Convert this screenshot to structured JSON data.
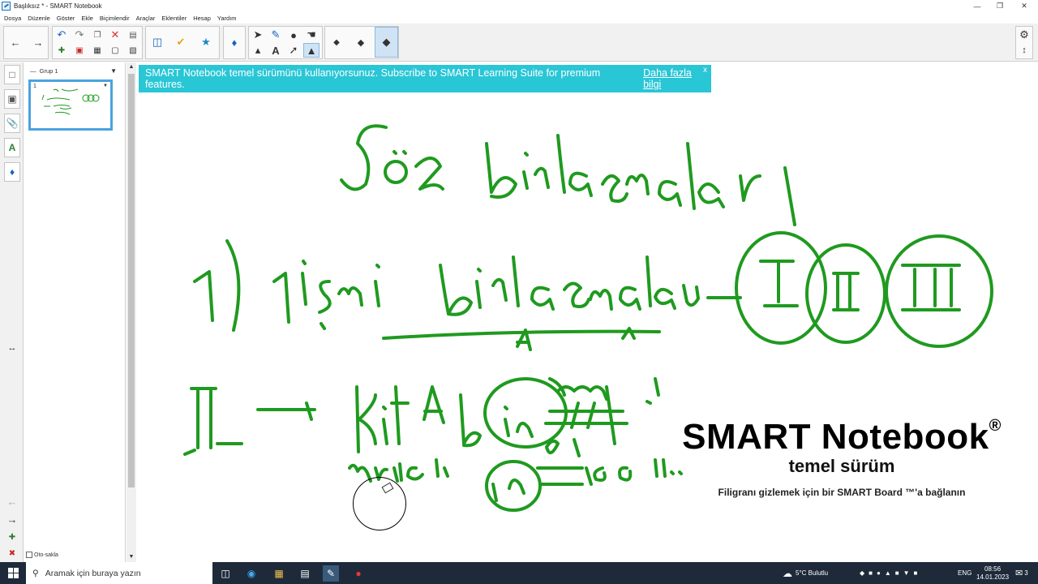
{
  "window": {
    "title": "Başlıksız * - SMART Notebook",
    "controls": [
      "minimize-icon",
      "restore-icon",
      "close-icon"
    ]
  },
  "menu": [
    "Dosya",
    "Düzenle",
    "Göster",
    "Ekle",
    "Biçimlendir",
    "Araçlar",
    "Eklentiler",
    "Hesap",
    "Yardım"
  ],
  "sidebar": {
    "group_label": "Grup 1",
    "page_number": "1",
    "autosave_label": "Oto-sakla"
  },
  "banner": {
    "text": "SMART Notebook temel sürümünü kullanıyorsunuz. Subscribe to SMART Learning Suite for premium features.",
    "link": "Daha fazla bilgi",
    "close": "x"
  },
  "watermark": {
    "title": "SMART Notebook",
    "registered": "®",
    "subtitle": "temel sürüm",
    "hint": "Filigranı gizlemek için bir SMART Board ™'a bağlanın"
  },
  "taskbar": {
    "search_placeholder": "Aramak için buraya yazın",
    "weather": "5°C  Bulutlu",
    "language": "ENG",
    "time": "08:56",
    "date": "14.01.2023",
    "notifications": "3"
  },
  "colors": {
    "ink": "#1f9a1f",
    "banner": "#29c6d6",
    "selected_tool": "#cfe3f5",
    "taskbar": "#1e2a3a"
  }
}
